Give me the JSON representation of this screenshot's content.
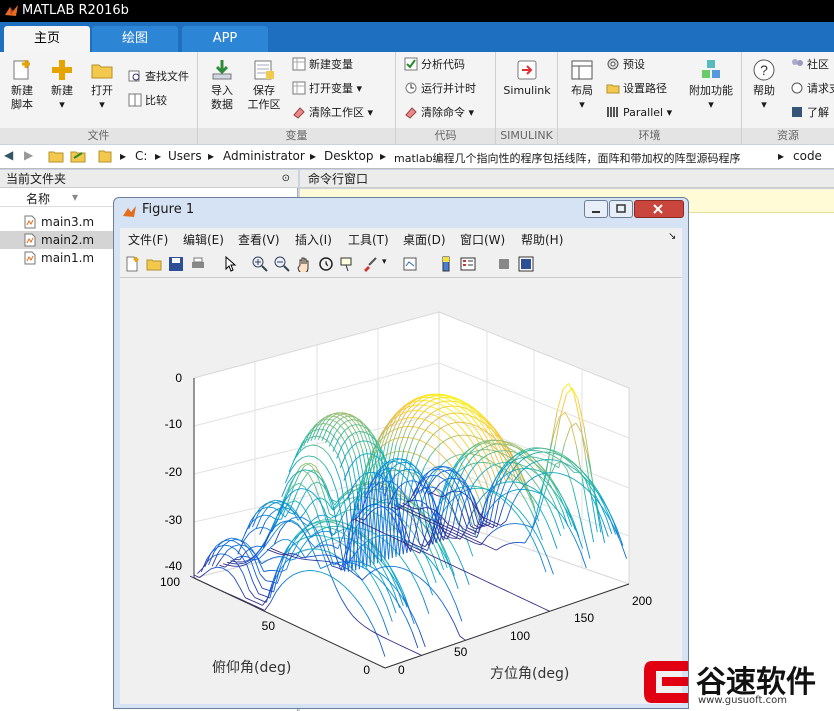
{
  "app": {
    "title": "MATLAB R2016b"
  },
  "tabs": [
    {
      "label": "主页",
      "active": true
    },
    {
      "label": "绘图",
      "active": false
    },
    {
      "label": "APP",
      "active": false
    }
  ],
  "ribbon": {
    "sections": {
      "file": "文件",
      "variable": "变量",
      "code": "代码",
      "simulink": "SIMULINK",
      "environment": "环境",
      "resources": "资源"
    },
    "new_script": [
      "新建",
      "脚本"
    ],
    "new": "新建",
    "open": "打开",
    "find_files": "查找文件",
    "compare": "比较",
    "import": [
      "导入",
      "数据"
    ],
    "save_ws": [
      "保存",
      "工作区"
    ],
    "new_var": "新建变量",
    "open_var": "打开变量",
    "clear_ws": "清除工作区",
    "analyze": "分析代码",
    "run_time": "运行并计时",
    "clear_cmd": "清除命令",
    "simulink": "Simulink",
    "layout": "布局",
    "prefs": "预设",
    "set_path": "设置路径",
    "parallel": "Parallel",
    "addons": "附加功能",
    "help": "帮助",
    "community": "社区",
    "request": "请求支",
    "learn": "了解"
  },
  "address": {
    "crumbs": [
      "C:",
      "Users",
      "Administrator",
      "Desktop",
      "matlab编程几个指向性的程序包括线阵，面阵和带加权的阵型源码程序",
      "code"
    ]
  },
  "left_pane": {
    "title": "当前文件夹",
    "col_name": "名称",
    "files": [
      "main3.m",
      "main2.m",
      "main1.m"
    ]
  },
  "command_window": {
    "title": "命令行窗口"
  },
  "figure": {
    "title": "Figure 1",
    "menu": [
      "文件(F)",
      "编辑(E)",
      "查看(V)",
      "插入(I)",
      "工具(T)",
      "桌面(D)",
      "窗口(W)",
      "帮助(H)"
    ],
    "z_ticks": [
      "0",
      "-10",
      "-20",
      "-30",
      "-40"
    ],
    "y_ticks": [
      "100",
      "50",
      "0"
    ],
    "x_ticks": [
      "0",
      "50",
      "100",
      "150",
      "200"
    ],
    "ylabel": "俯仰角(deg)",
    "xlabel": "方位角(deg)"
  },
  "watermark": {
    "name": "谷速软件",
    "url": "www.gusuoft.com"
  },
  "colors": {
    "accent": "#1e6fbf",
    "ribbon": "#f4f4f4"
  }
}
